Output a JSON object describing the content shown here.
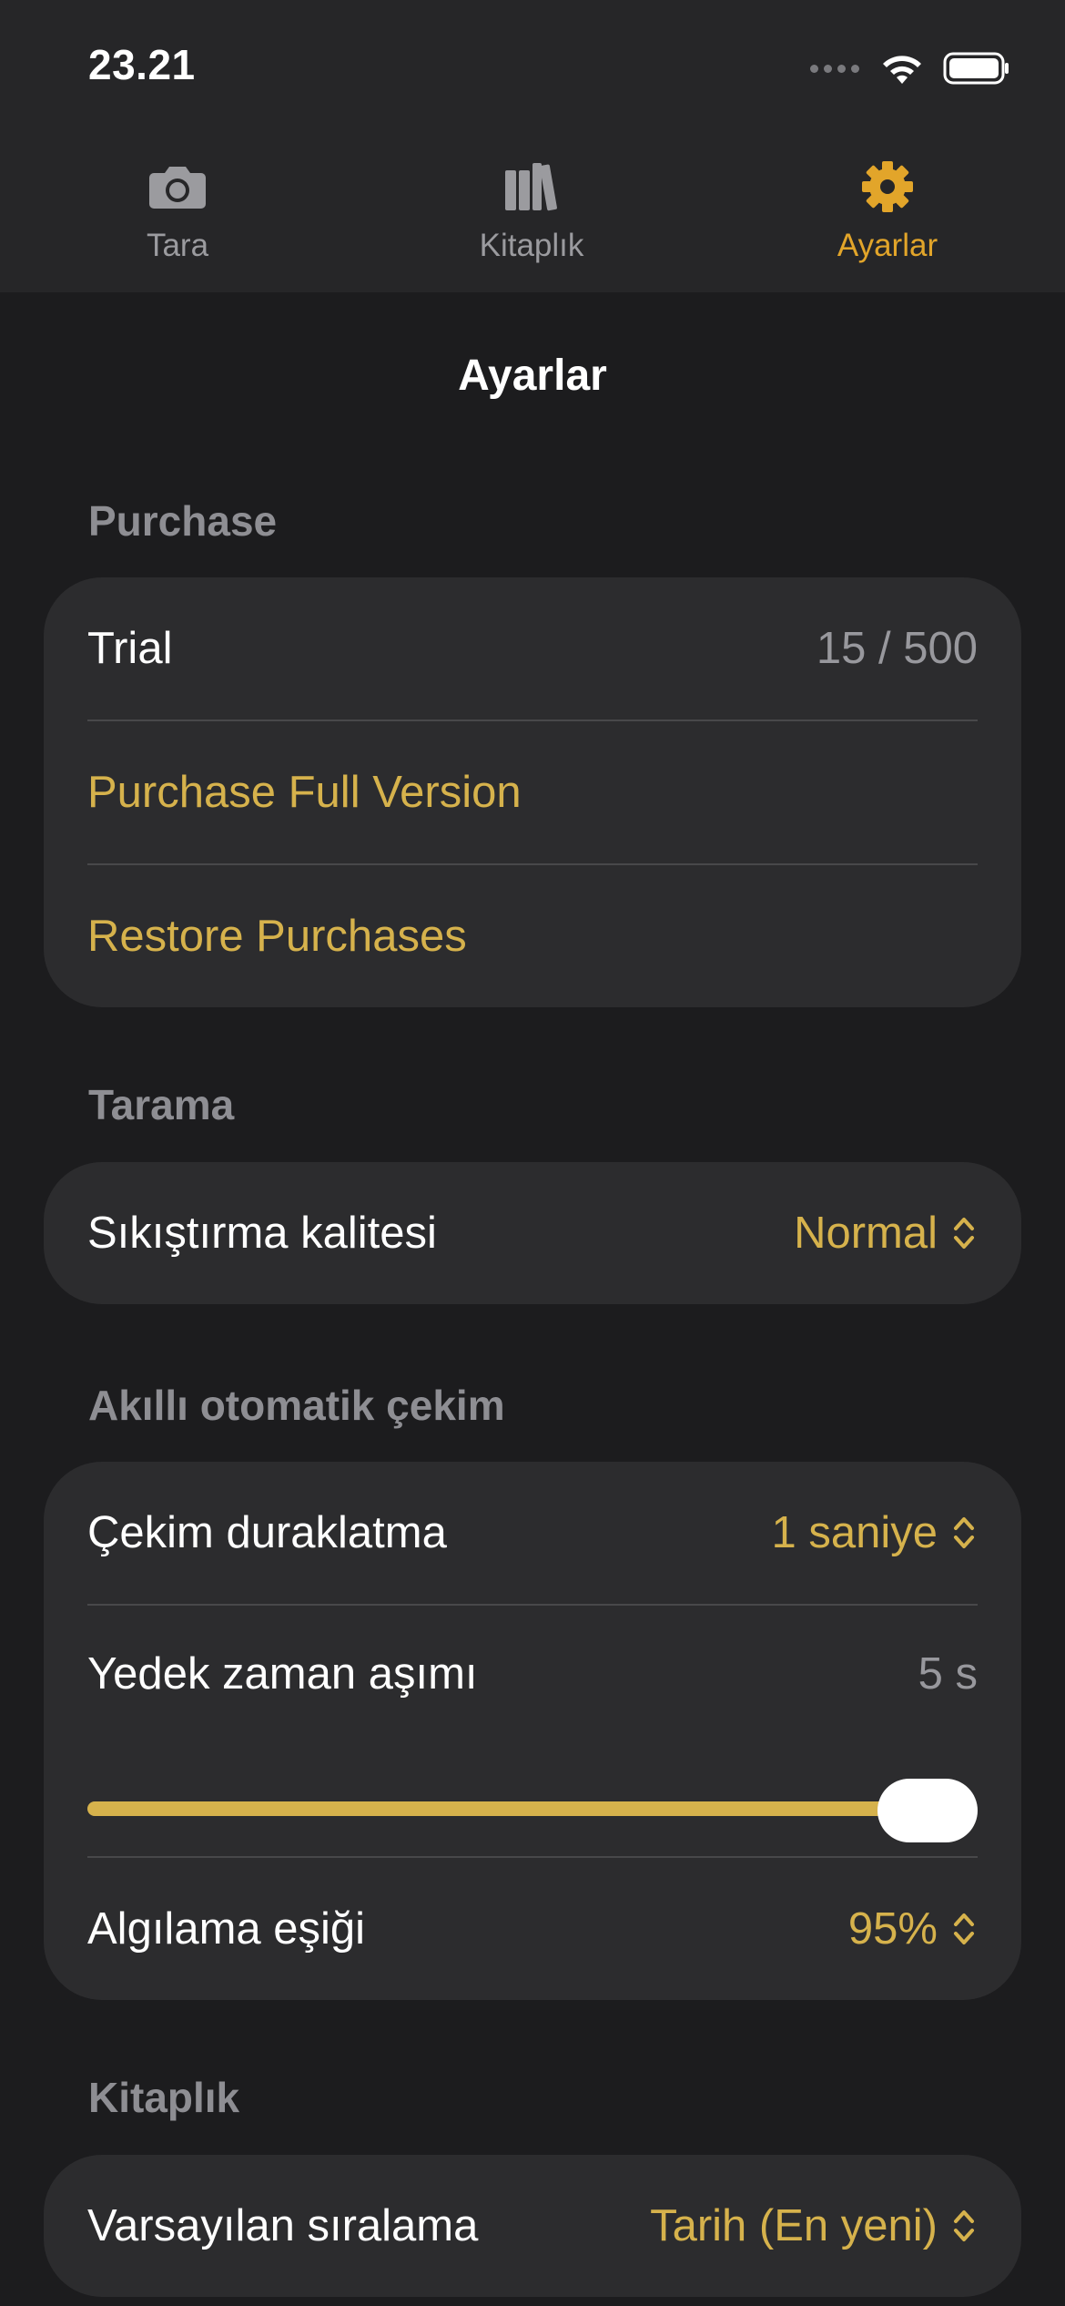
{
  "status_bar": {
    "time": "23.21"
  },
  "tabs": [
    {
      "label": "Tara",
      "icon": "camera-icon",
      "active": false
    },
    {
      "label": "Kitaplık",
      "icon": "books-icon",
      "active": false
    },
    {
      "label": "Ayarlar",
      "icon": "gear-icon",
      "active": true
    }
  ],
  "nav": {
    "title": "Ayarlar"
  },
  "purchase": {
    "header": "Purchase",
    "trial_label": "Trial",
    "trial_value": "15 / 500",
    "purchase_full": "Purchase Full Version",
    "restore": "Restore Purchases"
  },
  "tarama": {
    "header": "Tarama",
    "compression_label": "Sıkıştırma kalitesi",
    "compression_value": "Normal"
  },
  "auto_capture": {
    "header": "Akıllı otomatik çekim",
    "pause_label": "Çekim duraklatma",
    "pause_value": "1 saniye",
    "timeout_label": "Yedek zaman aşımı",
    "timeout_value": "5 s",
    "timeout_slider_fraction": 1.0,
    "threshold_label": "Algılama eşiği",
    "threshold_value": "95%"
  },
  "library": {
    "header": "Kitaplık",
    "sort_label": "Varsayılan sıralama",
    "sort_value": "Tarih (En yeni)"
  },
  "colors": {
    "accent": "#d6b24c",
    "active_tab": "#e2a52a",
    "background": "#1c1c1e",
    "card": "#2c2c2e"
  }
}
